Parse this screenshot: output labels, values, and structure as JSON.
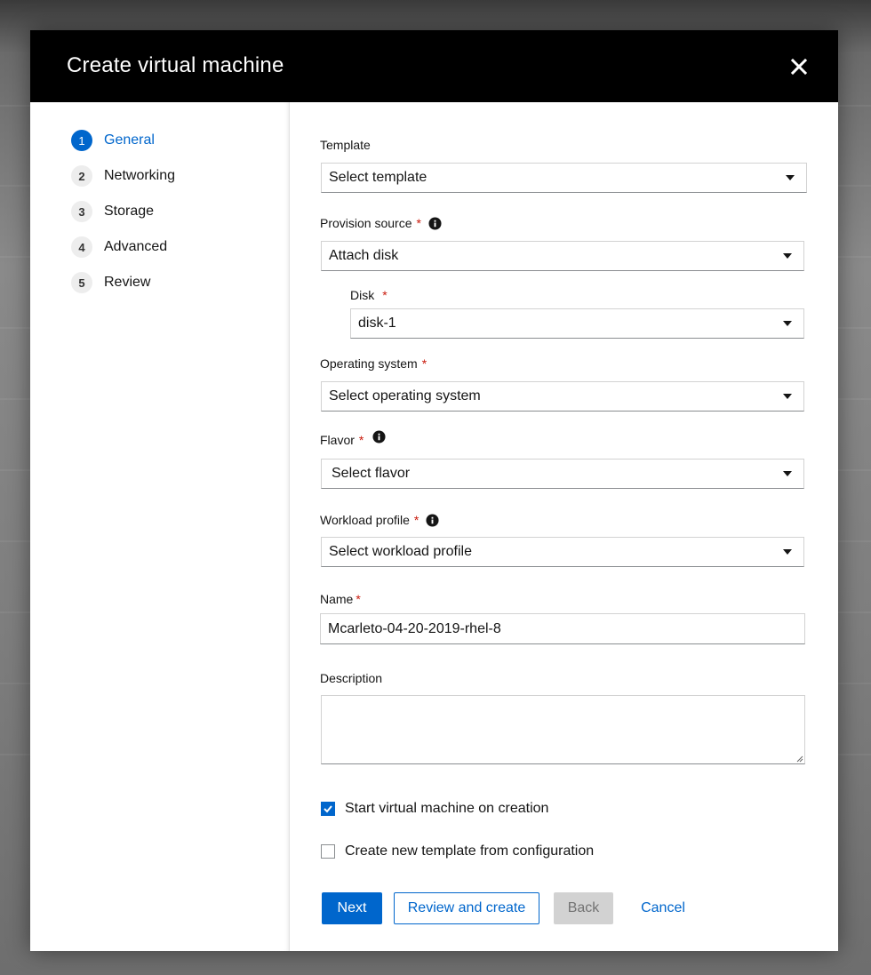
{
  "modal": {
    "title": "Create virtual machine"
  },
  "nav": {
    "steps": [
      {
        "number": "1",
        "label": "General",
        "active": true
      },
      {
        "number": "2",
        "label": "Networking",
        "active": false
      },
      {
        "number": "3",
        "label": "Storage",
        "active": false
      },
      {
        "number": "4",
        "label": "Advanced",
        "active": false
      },
      {
        "number": "5",
        "label": "Review",
        "active": false
      }
    ]
  },
  "form": {
    "template": {
      "label": "Template",
      "value": "Select template"
    },
    "provision_source": {
      "label": "Provision source",
      "required": "*",
      "value": "Attach disk"
    },
    "disk": {
      "label": "Disk",
      "required": "*",
      "value": "disk-1"
    },
    "operating_system": {
      "label": "Operating system",
      "required": "*",
      "value": "Select operating system"
    },
    "flavor": {
      "label": "Flavor",
      "required": "*",
      "value": "Select flavor"
    },
    "workload_profile": {
      "label": "Workload profile",
      "required": "*",
      "value": "Select workload profile"
    },
    "name": {
      "label": "Name",
      "required": "*",
      "value": "Mcarleto-04-20-2019-rhel-8"
    },
    "description": {
      "label": "Description",
      "value": ""
    },
    "start_on_creation": {
      "label": "Start virtual machine on creation",
      "checked": true
    },
    "create_template": {
      "label": "Create new template from configuration",
      "checked": false
    }
  },
  "buttons": {
    "next": "Next",
    "review_and_create": "Review and create",
    "back": "Back",
    "cancel": "Cancel"
  },
  "colors": {
    "accent": "#0066cc",
    "header_bg": "#000000",
    "required": "#c9190b",
    "disabled_bg": "#d2d2d2"
  },
  "icons": {
    "close": "close-icon",
    "info": "info-circle-icon",
    "caret": "caret-down-icon",
    "check": "check-icon"
  }
}
